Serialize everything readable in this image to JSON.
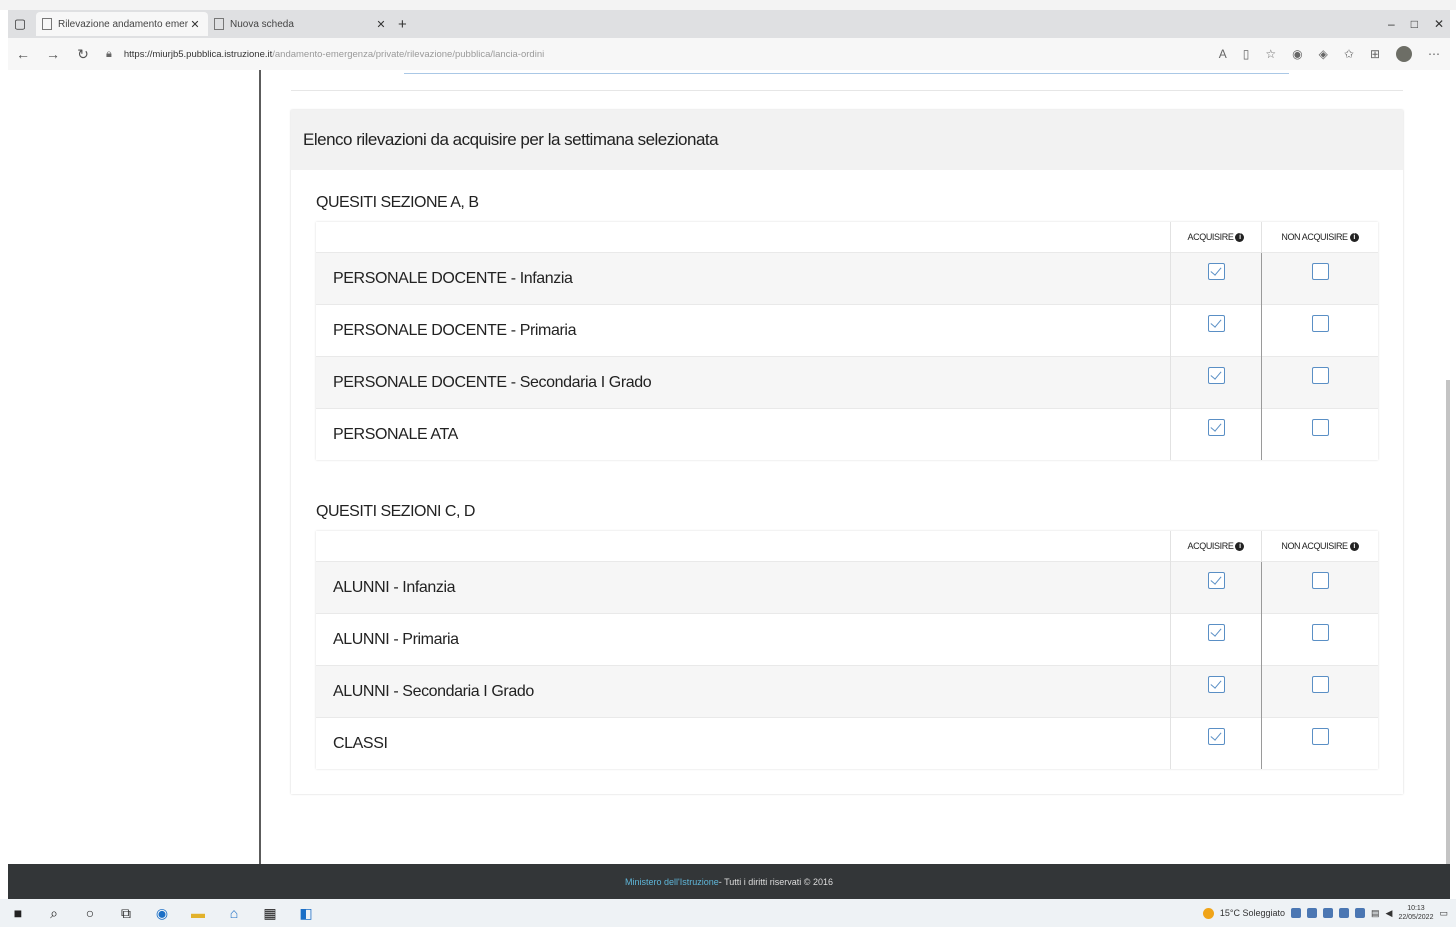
{
  "browser": {
    "tabs": [
      {
        "title": "Rilevazione andamento emergo",
        "active": true
      },
      {
        "title": "Nuova scheda",
        "active": false
      }
    ],
    "url_host": "https://miurjb5.pubblica.istruzione.it",
    "url_path": "/andamento-emergenza/private/rilevazione/pubblica/lancia-ordini",
    "window_controls": [
      "–",
      "□",
      "✕"
    ]
  },
  "card": {
    "header": "Elenco rilevazioni da acquisire per la settimana selezionata"
  },
  "columns": {
    "acquire": "ACQUISIRE",
    "not_acquire": "NON ACQUISIRE"
  },
  "sections": [
    {
      "title": "QUESITI SEZIONE A, B",
      "rows": [
        {
          "label": "PERSONALE DOCENTE - Infanzia",
          "acquire": true,
          "not_acquire": false
        },
        {
          "label": "PERSONALE DOCENTE - Primaria",
          "acquire": true,
          "not_acquire": false
        },
        {
          "label": "PERSONALE DOCENTE - Secondaria I Grado",
          "acquire": true,
          "not_acquire": false
        },
        {
          "label": "PERSONALE ATA",
          "acquire": true,
          "not_acquire": false
        }
      ]
    },
    {
      "title": "QUESITI SEZIONI C, D",
      "rows": [
        {
          "label": "ALUNNI - Infanzia",
          "acquire": true,
          "not_acquire": false
        },
        {
          "label": "ALUNNI - Primaria",
          "acquire": true,
          "not_acquire": false
        },
        {
          "label": "ALUNNI - Secondaria I Grado",
          "acquire": true,
          "not_acquire": false
        },
        {
          "label": "CLASSI",
          "acquire": true,
          "not_acquire": false
        }
      ]
    }
  ],
  "footer": {
    "owner": "Ministero dell'Istruzione",
    "rights": " - Tutti i diritti riservati © 2016"
  },
  "taskbar": {
    "weather": "15°C Soleggiato",
    "time": "10:13",
    "date": "22/05/2022"
  }
}
